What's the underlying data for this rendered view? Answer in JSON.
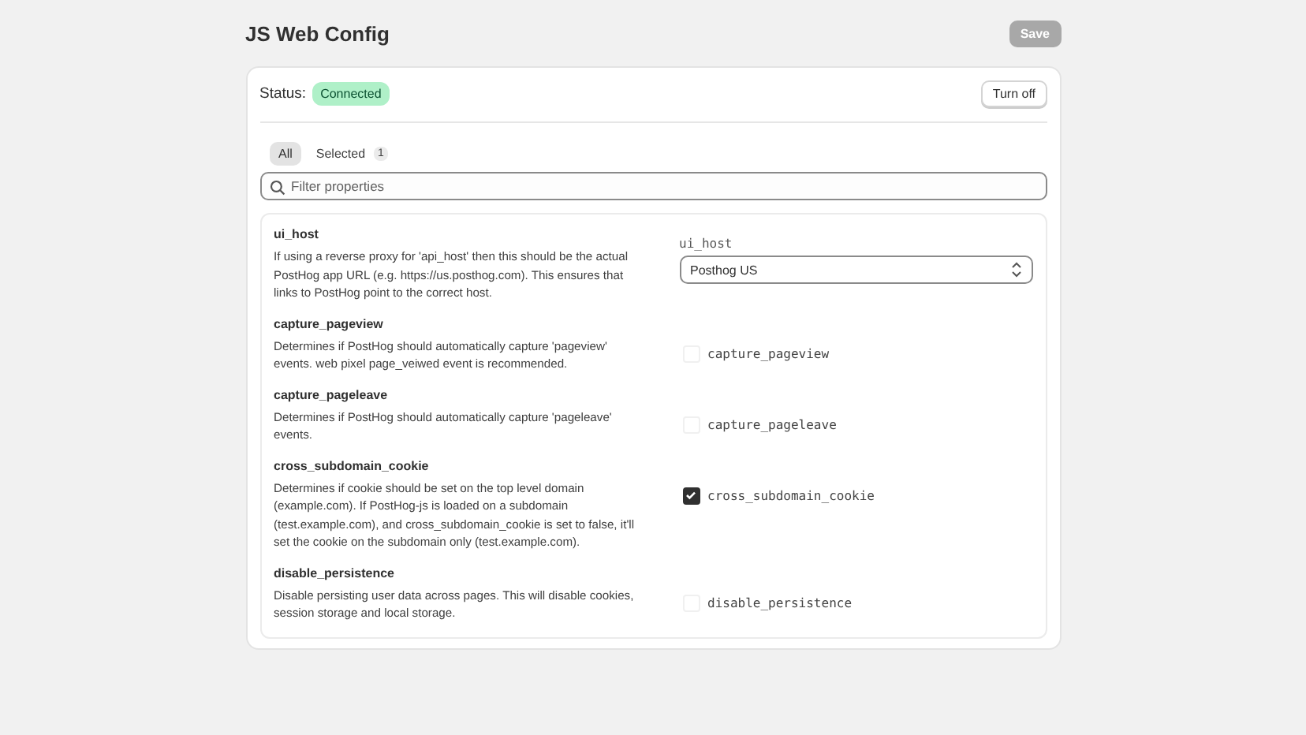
{
  "page_title": "JS Web Config",
  "save_button": {
    "label": "Save",
    "disabled": true
  },
  "status": {
    "label": "Status:",
    "badge": "Connected"
  },
  "turn_off_button": "Turn off",
  "tabs": [
    {
      "label": "All",
      "selected": true
    },
    {
      "label": "Selected",
      "count": "1",
      "selected": false
    }
  ],
  "search": {
    "placeholder": "Filter properties"
  },
  "properties": [
    {
      "kind": "select",
      "name": "ui_host",
      "description": "If using a reverse proxy for 'api_host' then this should be the actual PostHog app URL (e.g. https://us.posthog.com). This ensures that links to PostHog point to the correct host.",
      "field_label": "ui_host",
      "value": "Posthog US"
    },
    {
      "kind": "checkbox",
      "name": "capture_pageview",
      "description": "Determines if PostHog should automatically capture 'pageview' events. web pixel page_veiwed event is recommended.",
      "field_label": "capture_pageview",
      "checked": false
    },
    {
      "kind": "checkbox",
      "name": "capture_pageleave",
      "description": "Determines if PostHog should automatically capture 'pageleave' events.",
      "field_label": "capture_pageleave",
      "checked": false
    },
    {
      "kind": "checkbox",
      "name": "cross_subdomain_cookie",
      "description": "Determines if cookie should be set on the top level domain (example.com). If PostHog-js is loaded on a subdomain (test.example.com), and cross_subdomain_cookie is set to false, it'll set the cookie on the subdomain only (test.example.com).",
      "field_label": "cross_subdomain_cookie",
      "checked": true
    },
    {
      "kind": "checkbox",
      "name": "disable_persistence",
      "description": "Disable persisting user data across pages. This will disable cookies, session storage and local storage.",
      "field_label": "disable_persistence",
      "checked": false
    }
  ]
}
